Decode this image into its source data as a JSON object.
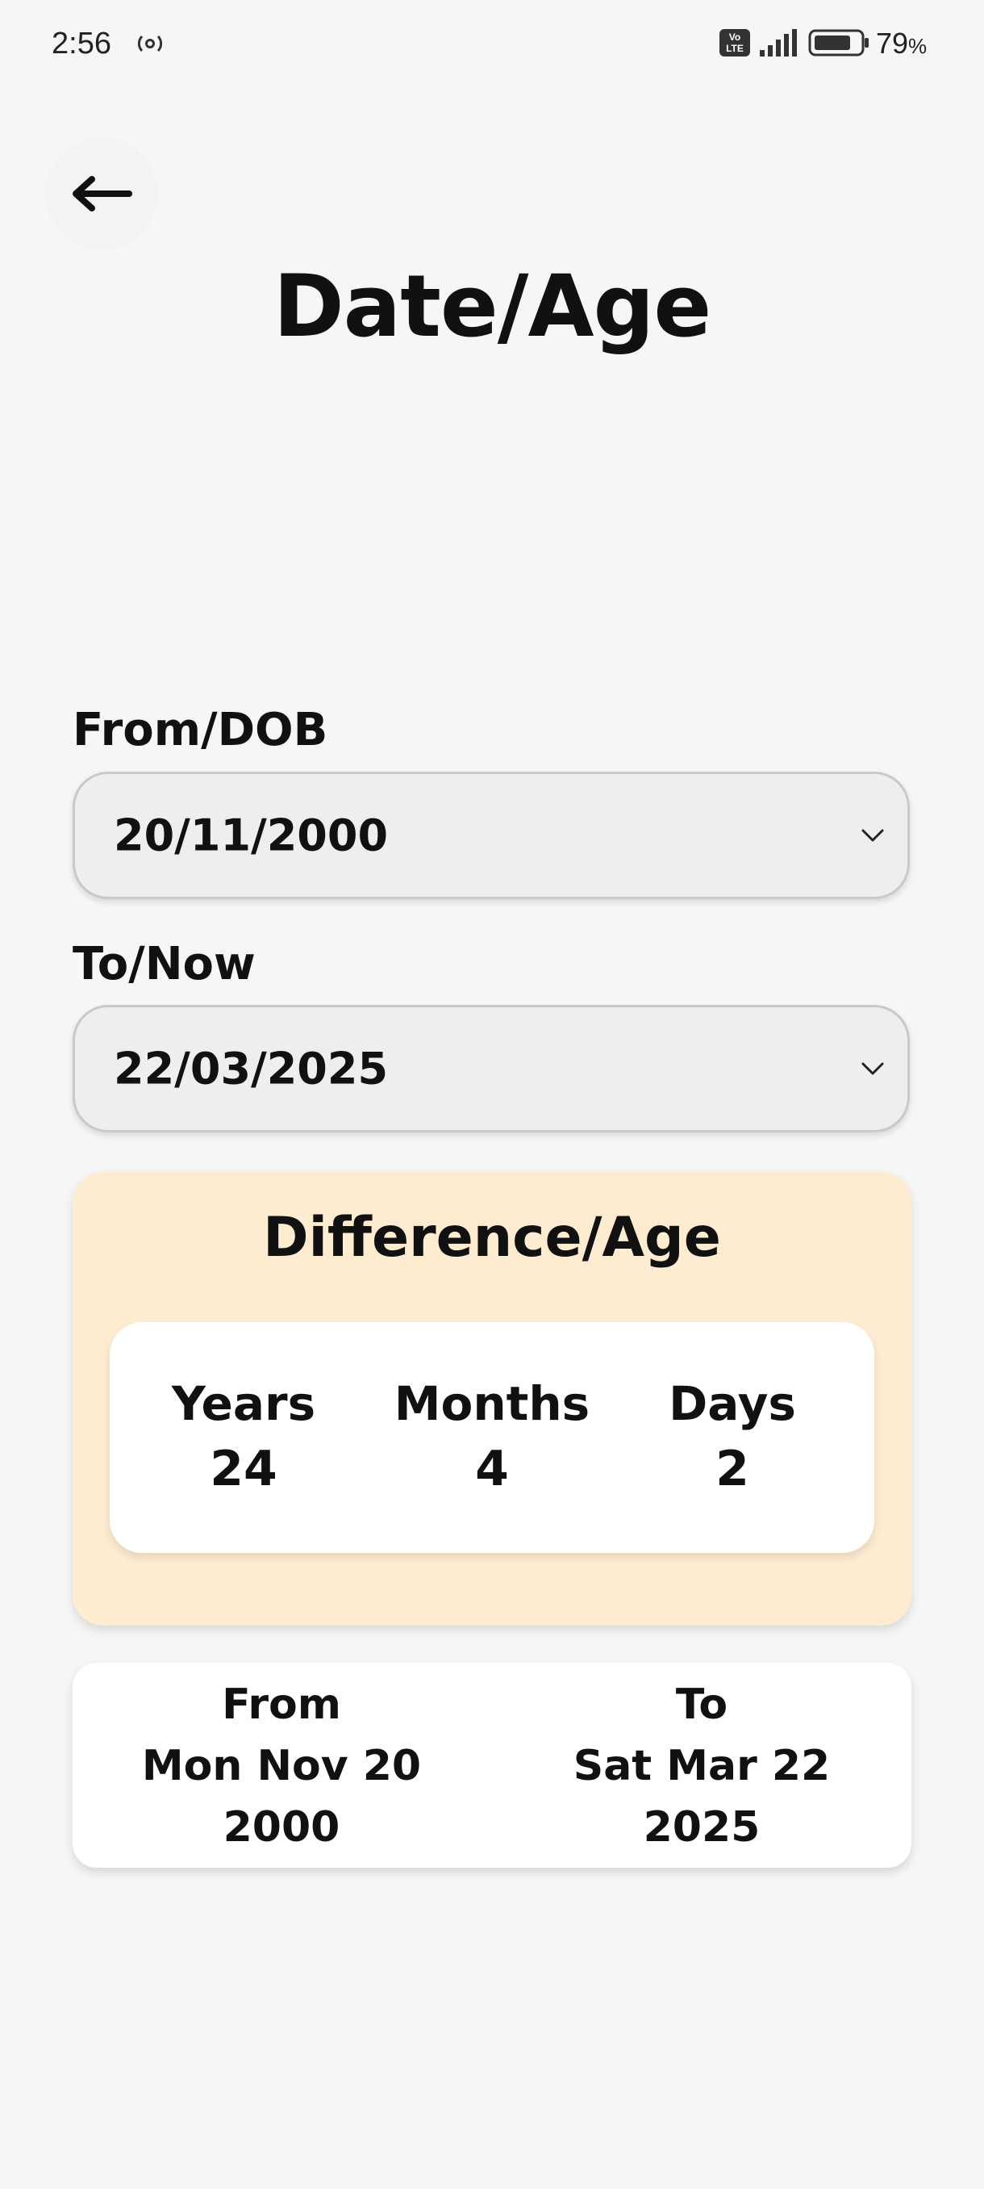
{
  "status_bar": {
    "time": "2:56",
    "battery_level": "79",
    "battery_unit": "%",
    "network_badge": "Vo LTE",
    "icons": [
      "hotspot-icon",
      "volte-icon",
      "signal-icon",
      "battery-icon"
    ]
  },
  "header": {
    "back_icon": "arrow-left-icon",
    "title": "Date/Age"
  },
  "form": {
    "from_label": "From/DOB",
    "from_value": "20/11/2000",
    "to_label": "To/Now",
    "to_value": "22/03/2025",
    "dropdown_icon": "chevron-down-icon"
  },
  "result": {
    "title": "Difference/Age",
    "columns": [
      {
        "label": "Years",
        "value": "24"
      },
      {
        "label": "Months",
        "value": "4"
      },
      {
        "label": "Days",
        "value": "2"
      }
    ]
  },
  "range": {
    "from": {
      "label": "From",
      "line1": "Mon Nov 20",
      "line2": "2000"
    },
    "to": {
      "label": "To",
      "line1": "Sat Mar 22",
      "line2": "2025"
    }
  },
  "colors": {
    "background": "#f6f6f6",
    "result_card": "#feecd1",
    "select_fill": "#eeeeee",
    "text": "#111111"
  }
}
